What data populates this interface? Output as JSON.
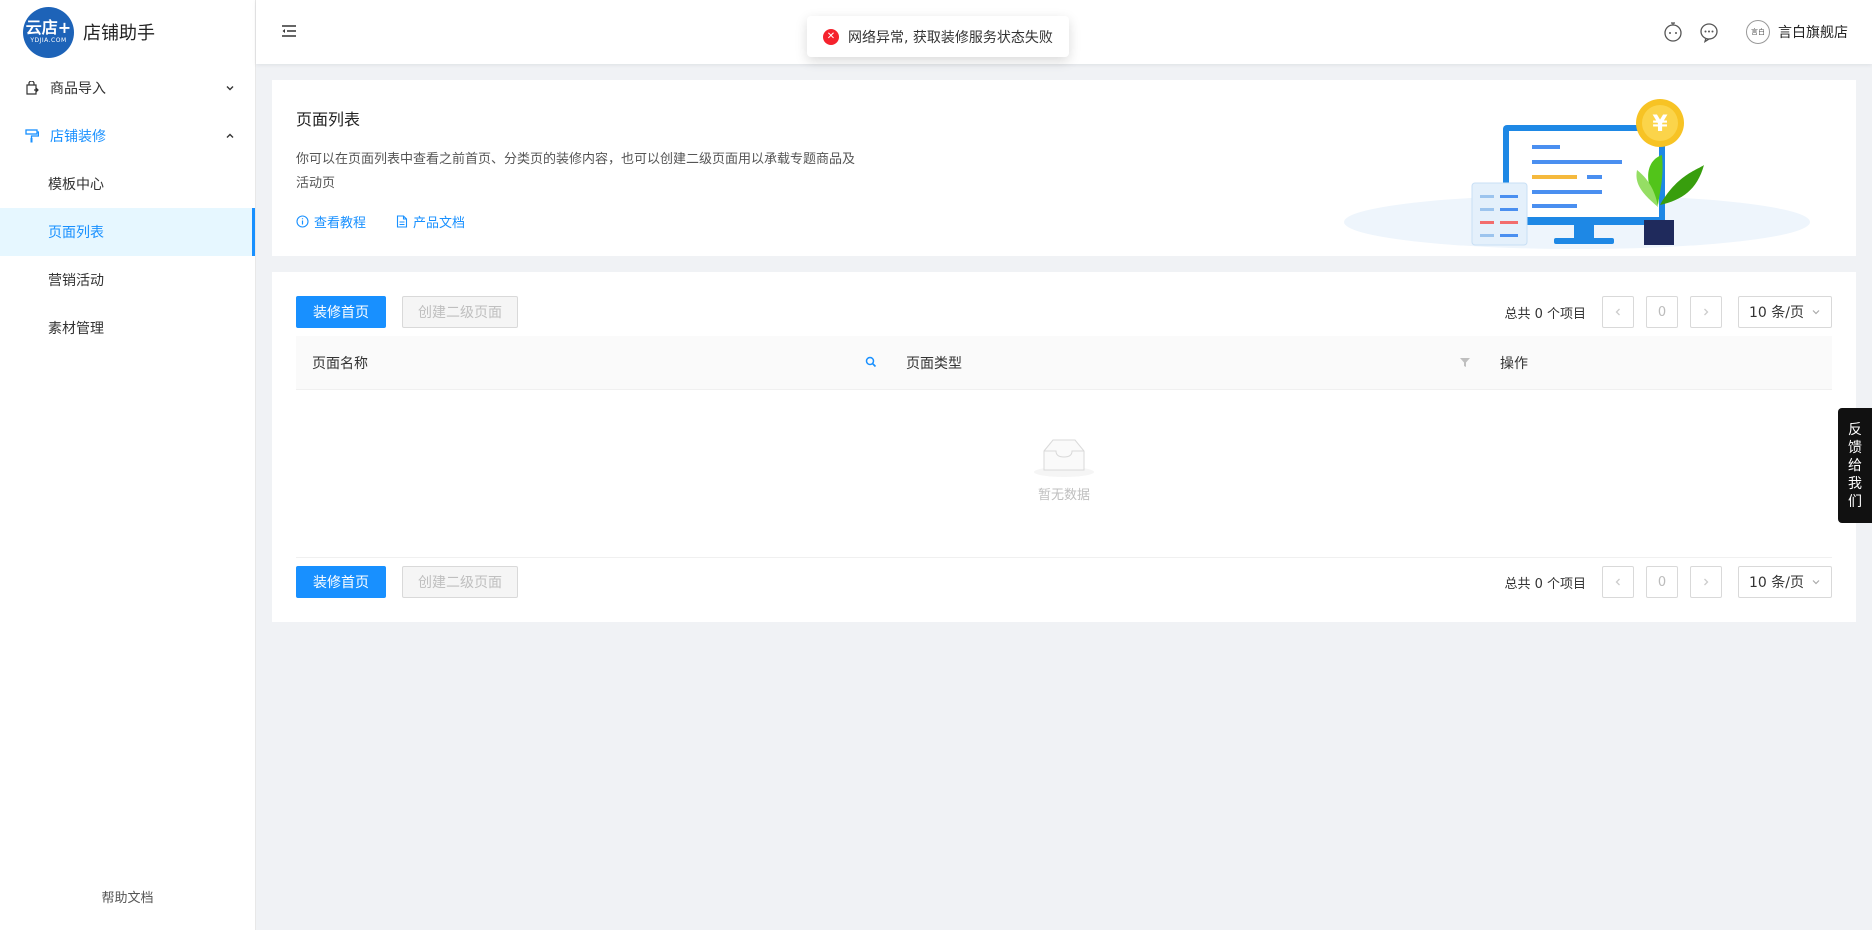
{
  "app": {
    "logo_main": "云店+",
    "logo_sub": "YDJIA.COM",
    "title": "店铺助手"
  },
  "sidebar": {
    "groups": [
      {
        "label": "商品导入",
        "expanded": false
      },
      {
        "label": "店铺装修",
        "expanded": true
      }
    ],
    "subitems": [
      {
        "label": "模板中心"
      },
      {
        "label": "页面列表",
        "selected": true
      },
      {
        "label": "营销活动"
      },
      {
        "label": "素材管理"
      }
    ],
    "help": "帮助文档"
  },
  "header": {
    "user_name": "言白旗舰店",
    "avatar_text": "言白"
  },
  "toast": {
    "message": "网络异常, 获取装修服务状态失败",
    "type": "error"
  },
  "intro": {
    "title": "页面列表",
    "desc": "你可以在页面列表中查看之前首页、分类页的装修内容，也可以创建二级页面用以承载专题商品及活动页",
    "links": [
      "查看教程",
      "产品文档"
    ]
  },
  "table": {
    "primary_button": "装修首页",
    "secondary_button": "创建二级页面",
    "total": "总共 0 个项目",
    "page": "0",
    "page_size": "10 条/页",
    "columns": [
      "页面名称",
      "页面类型",
      "操作"
    ],
    "empty_text": "暂无数据"
  },
  "feedback": [
    "反",
    "馈",
    "给",
    "我",
    "们"
  ],
  "colors": {
    "primary": "#1890ff",
    "error": "#f5222d",
    "logo": "#1d63b8"
  }
}
